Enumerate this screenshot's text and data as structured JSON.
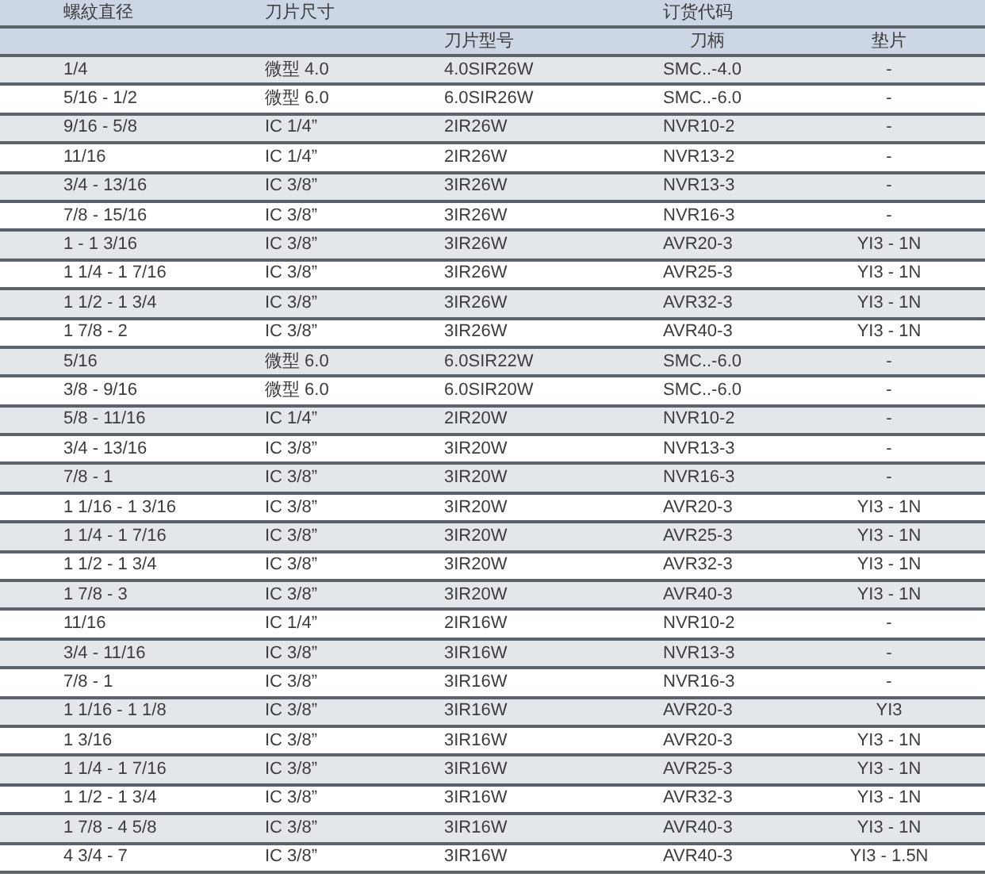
{
  "table": {
    "group_headers": [
      "螺紋直径",
      "刀片尺寸",
      "订货代码"
    ],
    "sub_headers": [
      "刀片型号",
      "刀柄",
      "垫片"
    ],
    "rows": [
      {
        "thread_diameter": "1/4",
        "insert_size": "微型 4.0",
        "insert_model": "4.0SIR26W",
        "holder": "SMC..-4.0",
        "shim": "-"
      },
      {
        "thread_diameter": "5/16 - 1/2",
        "insert_size": "微型 6.0",
        "insert_model": "6.0SIR26W",
        "holder": "SMC..-6.0",
        "shim": "-"
      },
      {
        "thread_diameter": "9/16 - 5/8",
        "insert_size": "IC 1/4”",
        "insert_model": "2IR26W",
        "holder": "NVR10-2",
        "shim": "-"
      },
      {
        "thread_diameter": "11/16",
        "insert_size": "IC 1/4”",
        "insert_model": "2IR26W",
        "holder": "NVR13-2",
        "shim": "-"
      },
      {
        "thread_diameter": "3/4 - 13/16",
        "insert_size": "IC 3/8”",
        "insert_model": "3IR26W",
        "holder": "NVR13-3",
        "shim": "-"
      },
      {
        "thread_diameter": "7/8 - 15/16",
        "insert_size": "IC 3/8”",
        "insert_model": "3IR26W",
        "holder": "NVR16-3",
        "shim": "-"
      },
      {
        "thread_diameter": "1 - 1 3/16",
        "insert_size": "IC 3/8”",
        "insert_model": "3IR26W",
        "holder": "AVR20-3",
        "shim": "YI3 - 1N"
      },
      {
        "thread_diameter": "1 1/4 - 1 7/16",
        "insert_size": "IC 3/8”",
        "insert_model": "3IR26W",
        "holder": "AVR25-3",
        "shim": "YI3 - 1N"
      },
      {
        "thread_diameter": "1 1/2 - 1 3/4",
        "insert_size": "IC 3/8”",
        "insert_model": "3IR26W",
        "holder": "AVR32-3",
        "shim": "YI3 - 1N"
      },
      {
        "thread_diameter": "1 7/8 - 2",
        "insert_size": "IC 3/8”",
        "insert_model": "3IR26W",
        "holder": "AVR40-3",
        "shim": "YI3 - 1N"
      },
      {
        "thread_diameter": "5/16",
        "insert_size": "微型 6.0",
        "insert_model": "6.0SIR22W",
        "holder": "SMC..-6.0",
        "shim": "-"
      },
      {
        "thread_diameter": "3/8 - 9/16",
        "insert_size": "微型 6.0",
        "insert_model": "6.0SIR20W",
        "holder": "SMC..-6.0",
        "shim": "-"
      },
      {
        "thread_diameter": "5/8 - 11/16",
        "insert_size": "IC 1/4”",
        "insert_model": "2IR20W",
        "holder": "NVR10-2",
        "shim": "-"
      },
      {
        "thread_diameter": "3/4 - 13/16",
        "insert_size": "IC 3/8”",
        "insert_model": "3IR20W",
        "holder": "NVR13-3",
        "shim": "-"
      },
      {
        "thread_diameter": "7/8 - 1",
        "insert_size": "IC 3/8”",
        "insert_model": "3IR20W",
        "holder": "NVR16-3",
        "shim": "-"
      },
      {
        "thread_diameter": "1 1/16 - 1 3/16",
        "insert_size": "IC 3/8”",
        "insert_model": "3IR20W",
        "holder": "AVR20-3",
        "shim": "YI3 - 1N"
      },
      {
        "thread_diameter": "1 1/4 - 1 7/16",
        "insert_size": "IC 3/8”",
        "insert_model": "3IR20W",
        "holder": "AVR25-3",
        "shim": "YI3 - 1N"
      },
      {
        "thread_diameter": "1 1/2 - 1 3/4",
        "insert_size": "IC 3/8”",
        "insert_model": "3IR20W",
        "holder": "AVR32-3",
        "shim": "YI3 - 1N"
      },
      {
        "thread_diameter": "1 7/8 - 3",
        "insert_size": "IC 3/8”",
        "insert_model": "3IR20W",
        "holder": "AVR40-3",
        "shim": "YI3 - 1N"
      },
      {
        "thread_diameter": "11/16",
        "insert_size": "IC 1/4”",
        "insert_model": "2IR16W",
        "holder": "NVR10-2",
        "shim": "-"
      },
      {
        "thread_diameter": "3/4 - 11/16",
        "insert_size": "IC 3/8”",
        "insert_model": "3IR16W",
        "holder": "NVR13-3",
        "shim": "-"
      },
      {
        "thread_diameter": "7/8 - 1",
        "insert_size": "IC 3/8”",
        "insert_model": "3IR16W",
        "holder": "NVR16-3",
        "shim": "-"
      },
      {
        "thread_diameter": "1 1/16 - 1 1/8",
        "insert_size": "IC 3/8”",
        "insert_model": "3IR16W",
        "holder": "AVR20-3",
        "shim": "YI3"
      },
      {
        "thread_diameter": "1 3/16",
        "insert_size": "IC 3/8”",
        "insert_model": "3IR16W",
        "holder": "AVR20-3",
        "shim": "YI3 - 1N"
      },
      {
        "thread_diameter": "1 1/4 - 1 7/16",
        "insert_size": "IC 3/8”",
        "insert_model": "3IR16W",
        "holder": "AVR25-3",
        "shim": "YI3 - 1N"
      },
      {
        "thread_diameter": "1 1/2 - 1 3/4",
        "insert_size": "IC 3/8”",
        "insert_model": "3IR16W",
        "holder": "AVR32-3",
        "shim": "YI3 - 1N"
      },
      {
        "thread_diameter": "1 7/8 - 4 5/8",
        "insert_size": "IC 3/8”",
        "insert_model": "3IR16W",
        "holder": "AVR40-3",
        "shim": "YI3 - 1N"
      },
      {
        "thread_diameter": "4 3/4 - 7",
        "insert_size": "IC 3/8”",
        "insert_model": "3IR16W",
        "holder": "AVR40-3",
        "shim": "YI3 - 1.5N"
      }
    ]
  }
}
